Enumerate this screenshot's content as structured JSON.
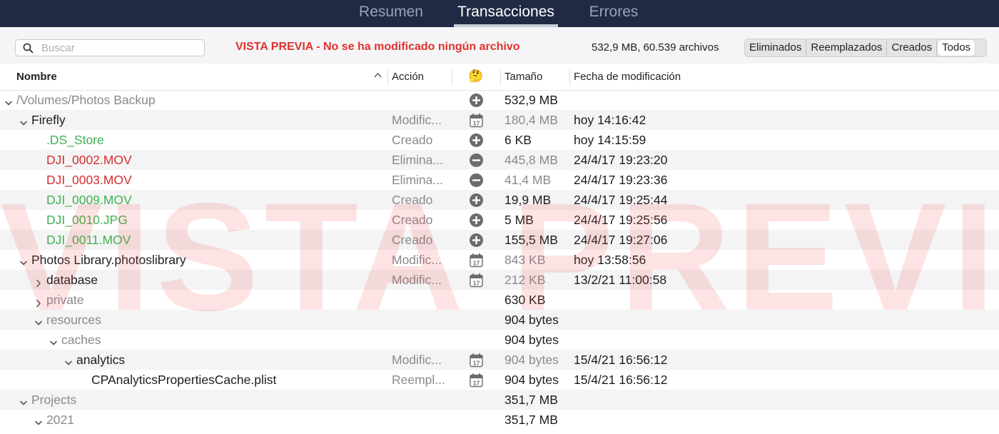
{
  "tabs": [
    {
      "label": "Resumen",
      "active": false
    },
    {
      "label": "Transacciones",
      "active": true
    },
    {
      "label": "Errores",
      "active": false
    }
  ],
  "toolbar": {
    "search_placeholder": "Buscar",
    "search_value": "",
    "preview_message": "VISTA PREVIA - No se ha modificado ningún archivo",
    "summary": "532,9 MB, 60.539 archivos",
    "filters": [
      {
        "label": "Eliminados",
        "selected": false
      },
      {
        "label": "Reemplazados",
        "selected": false
      },
      {
        "label": "Creados",
        "selected": false
      },
      {
        "label": "Todos",
        "selected": true
      }
    ]
  },
  "columns": {
    "name": "Nombre",
    "action": "Acción",
    "icon": "🤔",
    "size": "Tamaño",
    "date": "Fecha de modificación"
  },
  "watermark": "VISTA PREVIA",
  "colors": {
    "topbar": "#1f2a44",
    "preview_red": "#e0322c",
    "created_green": "#3fb34f",
    "deleted_red": "#d42f2f"
  },
  "rows": [
    {
      "level": 0,
      "chevron": "down",
      "name": "/Volumes/Photos Backup",
      "name_color": "gray",
      "action": "",
      "icon": "plus-circle-icon",
      "size": "532,9 MB",
      "size_color": "black",
      "date": ""
    },
    {
      "level": 1,
      "chevron": "down",
      "name": "Firefly",
      "name_color": "black",
      "action": "Modific...",
      "icon": "calendar-icon",
      "size": "180,4 MB",
      "size_color": "gray",
      "date": "hoy 14:16:42"
    },
    {
      "level": 2,
      "chevron": "",
      "name": ".DS_Store",
      "name_color": "green",
      "action": "Creado",
      "icon": "plus-circle-icon",
      "size": "6 KB",
      "size_color": "black",
      "date": "hoy 14:15:59"
    },
    {
      "level": 2,
      "chevron": "",
      "name": "DJI_0002.MOV",
      "name_color": "red",
      "action": "Elimina...",
      "icon": "minus-circle-icon",
      "size": "445,8 MB",
      "size_color": "gray",
      "date": "24/4/17 19:23:20"
    },
    {
      "level": 2,
      "chevron": "",
      "name": "DJI_0003.MOV",
      "name_color": "red",
      "action": "Elimina...",
      "icon": "minus-circle-icon",
      "size": "41,4 MB",
      "size_color": "gray",
      "date": "24/4/17 19:23:36"
    },
    {
      "level": 2,
      "chevron": "",
      "name": "DJI_0009.MOV",
      "name_color": "green",
      "action": "Creado",
      "icon": "plus-circle-icon",
      "size": "19,9 MB",
      "size_color": "black",
      "date": "24/4/17 19:25:44"
    },
    {
      "level": 2,
      "chevron": "",
      "name": "DJI_0010.JPG",
      "name_color": "green",
      "action": "Creado",
      "icon": "plus-circle-icon",
      "size": "5 MB",
      "size_color": "black",
      "date": "24/4/17 19:25:56"
    },
    {
      "level": 2,
      "chevron": "",
      "name": "DJI_0011.MOV",
      "name_color": "green",
      "action": "Creado",
      "icon": "plus-circle-icon",
      "size": "155,5 MB",
      "size_color": "black",
      "date": "24/4/17 19:27:06"
    },
    {
      "level": 1,
      "chevron": "down",
      "name": "Photos Library.photoslibrary",
      "name_color": "black",
      "action": "Modific...",
      "icon": "calendar-icon",
      "size": "843 KB",
      "size_color": "gray",
      "date": "hoy 13:58:56"
    },
    {
      "level": 2,
      "chevron": "right",
      "name": "database",
      "name_color": "black",
      "action": "Modific...",
      "icon": "calendar-icon",
      "size": "212 KB",
      "size_color": "gray",
      "date": "13/2/21 11:00:58"
    },
    {
      "level": 2,
      "chevron": "right",
      "name": "private",
      "name_color": "gray",
      "action": "",
      "icon": "",
      "size": "630 KB",
      "size_color": "black",
      "date": ""
    },
    {
      "level": 2,
      "chevron": "down",
      "name": "resources",
      "name_color": "gray",
      "action": "",
      "icon": "",
      "size": "904 bytes",
      "size_color": "black",
      "date": ""
    },
    {
      "level": 3,
      "chevron": "down",
      "name": "caches",
      "name_color": "gray",
      "action": "",
      "icon": "",
      "size": "904 bytes",
      "size_color": "black",
      "date": ""
    },
    {
      "level": 4,
      "chevron": "down",
      "name": "analytics",
      "name_color": "black",
      "action": "Modific...",
      "icon": "calendar-icon",
      "size": "904 bytes",
      "size_color": "gray",
      "date": "15/4/21 16:56:12"
    },
    {
      "level": 5,
      "chevron": "",
      "name": "CPAnalyticsPropertiesCache.plist",
      "name_color": "black",
      "action": "Reempl...",
      "icon": "calendar-icon",
      "size": "904 bytes",
      "size_color": "black",
      "date": "15/4/21 16:56:12"
    },
    {
      "level": 1,
      "chevron": "down",
      "name": "Projects",
      "name_color": "gray",
      "action": "",
      "icon": "",
      "size": "351,7 MB",
      "size_color": "black",
      "date": ""
    },
    {
      "level": 2,
      "chevron": "down",
      "name": "2021",
      "name_color": "gray",
      "action": "",
      "icon": "",
      "size": "351,7 MB",
      "size_color": "black",
      "date": ""
    }
  ]
}
